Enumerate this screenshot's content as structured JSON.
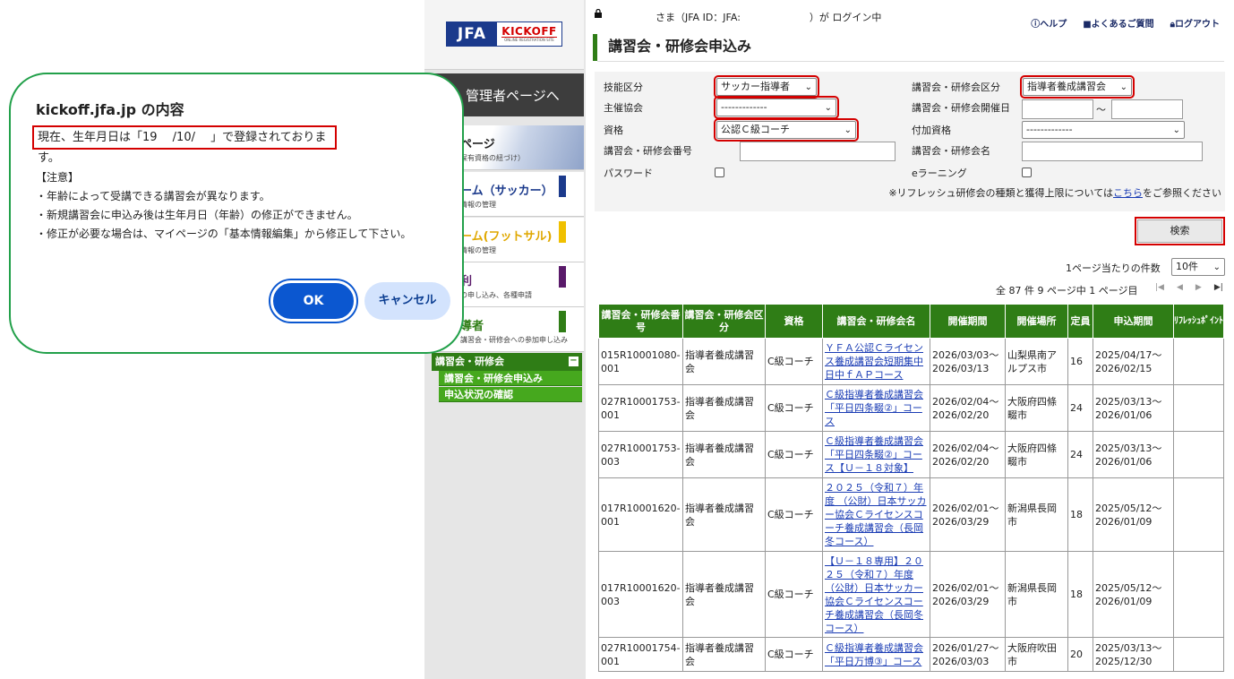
{
  "sidebar": {
    "logo_main": "JFA",
    "logo_kickoff": "KICKOFF",
    "logo_sub": "ONLINE REGISTRATION SITE",
    "admin_button": "管理者ページへ",
    "cards": [
      {
        "title": "ページ",
        "sub": "保有資格の紐づけ）",
        "tag_color": ""
      },
      {
        "title": "ーム（サッカー）",
        "sub": "情報の管理",
        "tag_color": "#1b3a8c"
      },
      {
        "title": "ーム(フットサル)",
        "sub": "情報の管理",
        "tag_color": "#f0c000"
      },
      {
        "title": "利",
        "sub": "の申し込み、各種申請",
        "tag_color": "#5a1a6a"
      },
      {
        "title": "導者",
        "sub": "講習会・研修会への参加申し込み",
        "tag_color": "#2f7d16"
      }
    ],
    "lecture_header": "講習会・研修会",
    "lecture_toggle": "−",
    "lecture_items": [
      "講習会・研修会申込み",
      "申込状況の確認"
    ]
  },
  "topbar": {
    "login_text": "さま（JFA ID：JFA:　　　　　　　）が ログイン中",
    "help": "ヘルプ",
    "faq": "よくあるご質問",
    "logout": "ログアウト"
  },
  "page_title": "講習会・研修会申込み",
  "search": {
    "skill_label": "技能区分",
    "skill_value": "サッカー指導者",
    "category_label": "講習会・研修会区分",
    "category_value": "指導者養成講習会",
    "host_label": "主催協会",
    "host_value": "-------------",
    "date_label": "講習会・研修会開催日",
    "date_sep": "～",
    "qual_label": "資格",
    "qual_value": "公認Ｃ級コーチ",
    "extra_label": "付加資格",
    "extra_value": "-------------",
    "number_label": "講習会・研修会番号",
    "name_label": "講習会・研修会名",
    "password_label": "パスワード",
    "elearning_label": "eラーニング",
    "note_prefix": "※リフレッシュ研修会の種類と獲得上限については",
    "note_link": "こちら",
    "note_suffix": "をご参照ください",
    "search_button": "検索"
  },
  "listing": {
    "per_page_label": "1ページ当たりの件数",
    "per_page_value": "10件",
    "summary": "全 87 件 9 ページ中 1 ページ目",
    "pager": [
      "|◀",
      "◀",
      "▶",
      "▶|"
    ]
  },
  "table": {
    "headers": [
      "講習会・研修会番号",
      "講習会・研修会区分",
      "資格",
      "講習会・研修会名",
      "開催期間",
      "開催場所",
      "定員",
      "申込期間",
      "ﾘﾌﾚｯｼｭﾎﾟｲﾝﾄ"
    ],
    "rows": [
      {
        "no": "015R10001080-001",
        "cat": "指導者養成講習会",
        "qual": "C級コーチ",
        "name": "ＹＦＡ公認Ｃライセンス養成講習会短期集中日中ｆＡＰコース",
        "period": "2026/03/03～2026/03/13",
        "place": "山梨県南アルプス市",
        "cap": "16",
        "apply": "2025/04/17～2026/02/15",
        "pt": ""
      },
      {
        "no": "027R10001753-001",
        "cat": "指導者養成講習会",
        "qual": "C級コーチ",
        "name": "Ｃ級指導者養成講習会「平日四条畷②」コース",
        "period": "2026/02/04～2026/02/20",
        "place": "大阪府四條畷市",
        "cap": "24",
        "apply": "2025/03/13～2026/01/06",
        "pt": ""
      },
      {
        "no": "027R10001753-003",
        "cat": "指導者養成講習会",
        "qual": "C級コーチ",
        "name": "Ｃ級指導者養成講習会「平日四条畷②」コース【Ｕ－１８対象】",
        "period": "2026/02/04～2026/02/20",
        "place": "大阪府四條畷市",
        "cap": "24",
        "apply": "2025/03/13～2026/01/06",
        "pt": ""
      },
      {
        "no": "017R10001620-001",
        "cat": "指導者養成講習会",
        "qual": "C級コーチ",
        "name": "２０２５（令和７）年度 （公財）日本サッカー協会Ｃライセンスコーチ養成講習会（長岡冬コース）",
        "period": "2026/02/01～2026/03/29",
        "place": "新潟県長岡市",
        "cap": "18",
        "apply": "2025/05/12～2026/01/09",
        "pt": ""
      },
      {
        "no": "017R10001620-003",
        "cat": "指導者養成講習会",
        "qual": "C級コーチ",
        "name": "【Ｕ－１８専用】２０２５（令和７）年度 （公財）日本サッカー協会Ｃライセンスコーチ養成講習会（長岡冬コース）",
        "period": "2026/02/01～2026/03/29",
        "place": "新潟県長岡市",
        "cap": "18",
        "apply": "2025/05/12～2026/01/09",
        "pt": ""
      },
      {
        "no": "027R10001754-001",
        "cat": "指導者養成講習会",
        "qual": "C級コーチ",
        "name": "Ｃ級指導者養成講習会「平日万博③」コース",
        "period": "2026/01/27～2026/03/03",
        "place": "大阪府吹田市",
        "cap": "20",
        "apply": "2025/03/13～2025/12/30",
        "pt": ""
      }
    ]
  },
  "dialog": {
    "title": "kickoff.jfa.jp の内容",
    "message": "現在、生年月日は「19　 /10/　 」で登録されております。",
    "notice_heading": "【注意】",
    "notice_lines": [
      "・年齢によって受講できる講習会が異なります。",
      "・新規講習会に申込み後は生年月日（年齢）の修正ができません。",
      "・修正が必要な場合は、マイページの「基本情報編集」から修正して下さい。"
    ],
    "ok": "OK",
    "cancel": "キャンセル"
  }
}
